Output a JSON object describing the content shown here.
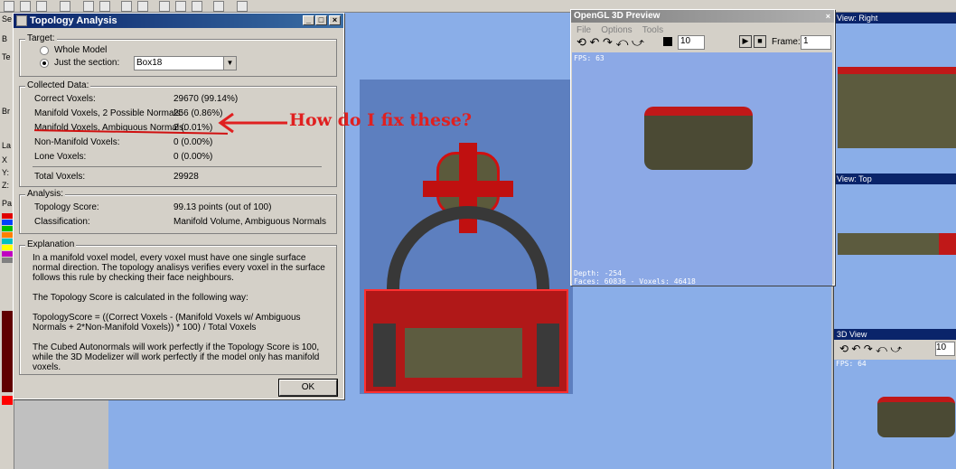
{
  "dialog": {
    "title": "Topology Analysis",
    "target": {
      "legend": "Target:",
      "whole_model": "Whole Model",
      "just_section": "Just the section:",
      "section_value": "Box18"
    },
    "collected": {
      "legend": "Collected Data:",
      "rows": [
        {
          "label": "Correct Voxels:",
          "value": "29670 (99.14%)"
        },
        {
          "label": "Manifold Voxels, 2 Possible Normals:",
          "value": "256 (0.86%)"
        },
        {
          "label": "Manifold Voxels, Ambiguous Normals:",
          "value": "2 (0.01%)"
        },
        {
          "label": "Non-Manifold Voxels:",
          "value": "0 (0.00%)"
        },
        {
          "label": "Lone Voxels:",
          "value": "0 (0.00%)"
        }
      ],
      "total_label": "Total Voxels:",
      "total_value": "29928"
    },
    "analysis": {
      "legend": "Analysis:",
      "score_label": "Topology Score:",
      "score_value": "99.13 points (out of 100)",
      "class_label": "Classification:",
      "class_value": "Manifold Volume, Ambiguous Normals"
    },
    "explanation": {
      "legend": "Explanation",
      "p1": "In a manifold voxel model, every voxel must have one single surface normal direction. The topology analisys verifies every voxel in the surface follows this rule by checking their face neighbours.",
      "p2": "The Topology Score is calculated in the following way:",
      "p3": "TopologyScore = ((Correct Voxels - (Manifold Voxels w/ Ambiguous Normals + 2*Non-Manifold Voxels)) * 100) / Total Voxels",
      "p4": "The Cubed Autonormals will work perfectly if the Topology Score is 100, while the 3D Modelizer will work perfectly if the model only has manifold voxels."
    },
    "ok_label": "OK"
  },
  "annotation": "How do I fix these?",
  "gl_preview": {
    "title": "OpenGL 3D Preview",
    "menu": [
      "File",
      "Options",
      "Tools"
    ],
    "zoom_value": "10",
    "frame_label": "Frame:",
    "frame_value": "1",
    "fps": "FPS: 63",
    "depth": "Depth: -254",
    "stats": "Faces: 60836 - Voxels: 46418"
  },
  "views": {
    "right_title": "View: Right",
    "top_title": "View: Top",
    "view3d_title": "3D View",
    "view3d_zoom": "10",
    "view3d_fps": "FPS: 64"
  },
  "left_strip_labels": [
    "Se",
    "B",
    "Te",
    "Br",
    "La",
    "X",
    "Y:",
    "Z:",
    "Pa"
  ],
  "colors": {
    "accent_red": "#e02020",
    "title_blue": "#0a246a",
    "viewport_blue": "#8aaee8"
  }
}
